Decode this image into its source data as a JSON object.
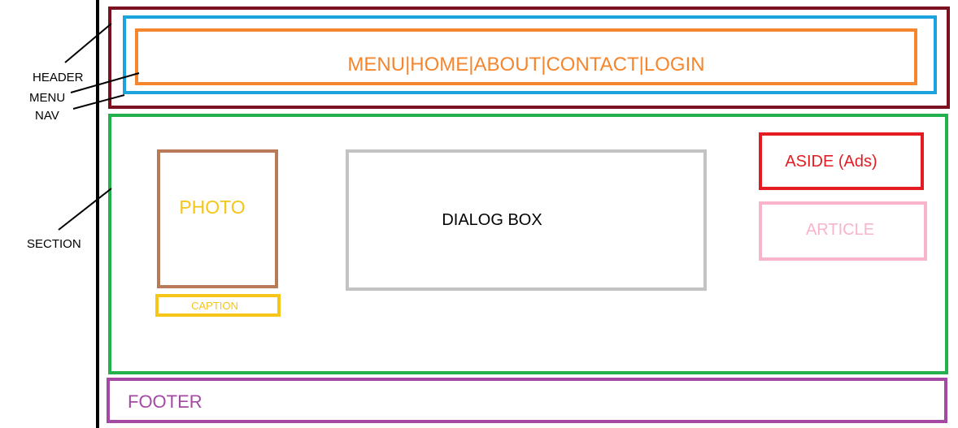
{
  "labels": {
    "header": "HEADER",
    "menu": "MENU",
    "nav": "NAV",
    "section": "SECTION"
  },
  "header": {
    "menu_text": "MENU|HOME|ABOUT|CONTACT|LOGIN"
  },
  "section": {
    "photo": "PHOTO",
    "caption": "CAPTION",
    "dialog": "DIALOG BOX",
    "aside": "ASIDE (Ads)",
    "article": "ARTICLE"
  },
  "footer": {
    "text": "FOOTER"
  },
  "colors": {
    "header": "#7b1020",
    "nav": "#1aa3dd",
    "menu": "#f5862e",
    "section": "#22b14c",
    "photo": "#b97a57",
    "caption": "#f5c518",
    "dialog": "#c3c3c3",
    "aside": "#e41b23",
    "article": "#f9b3cc",
    "footer": "#a349a4"
  }
}
